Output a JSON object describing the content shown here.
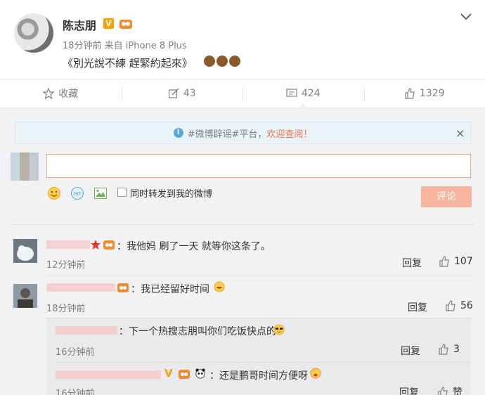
{
  "post": {
    "author": "陈志朋",
    "verified_badge": "V",
    "meta": "18分钟前 来自 iPhone 8 Plus",
    "text": "《別光說不練 趕緊約起來》"
  },
  "actions": {
    "favorite": "收藏",
    "repost_count": "43",
    "comment_count": "424",
    "like_count": "1329"
  },
  "notice": {
    "prefix": "#微博辟谣#平台，",
    "link": "欢迎查阅！",
    "close": "×"
  },
  "composer": {
    "forward_label": "同时转发到我的微博",
    "submit": "评论"
  },
  "comments": [
    {
      "text": "：我他妈 刷了一天 就等你这条了。",
      "time": "12分钟前",
      "reply": "回复",
      "likes": "107"
    },
    {
      "text": "：我已经留好时间",
      "time": "18分钟前",
      "reply": "回复",
      "likes": "56"
    }
  ],
  "replies": [
    {
      "text": "：下一个热搜志朋叫你们吃饭快点的",
      "time": "16分钟前",
      "reply": "回复",
      "likes": "3"
    },
    {
      "text": "：还是鹏哥时间方便呀",
      "time": "16分钟前",
      "reply": "回复",
      "likes": "赞"
    }
  ],
  "colors": {
    "accent": "#eb7350",
    "submit_bg": "#f7b59f",
    "info_blue": "#59a8d8",
    "verified": "#f5a300"
  }
}
